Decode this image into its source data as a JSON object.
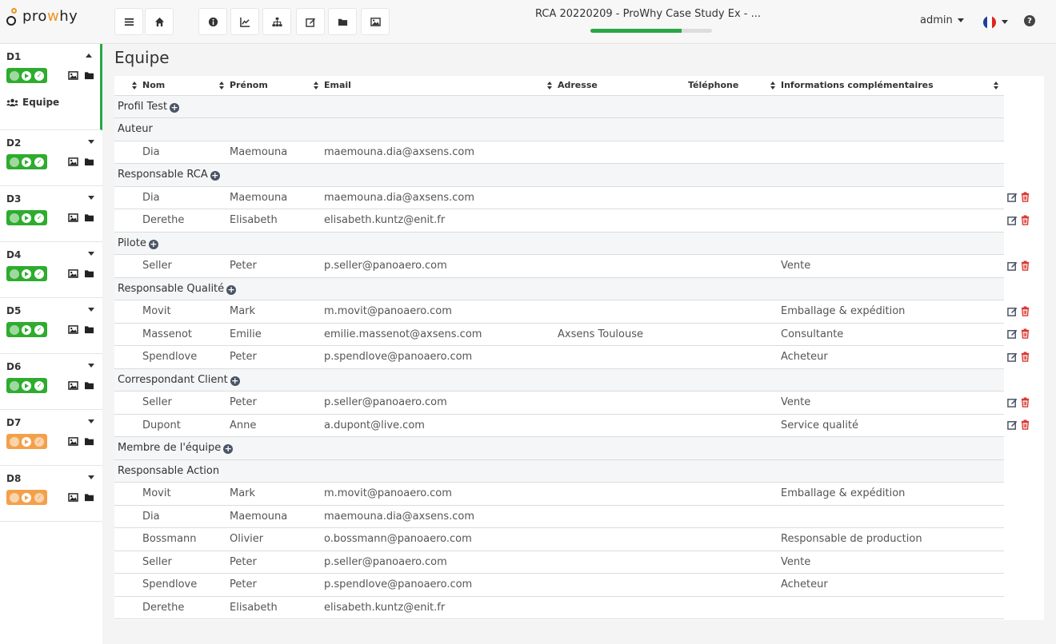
{
  "app": {
    "logo_text_a": "pro",
    "logo_text_b": "w",
    "logo_text_c": "hy"
  },
  "header": {
    "doc_title": "RCA 20220209 - ProWhy Case Study Ex - ...",
    "progress": 0.75,
    "user": "admin",
    "toolbar": [
      "menu-icon",
      "home-icon",
      "info-icon",
      "chart-icon",
      "sitemap-icon",
      "edit-icon",
      "folder-icon",
      "image-icon"
    ]
  },
  "sidebar": {
    "steps": [
      {
        "label": "D1",
        "status": "green",
        "active": true,
        "sub": "Equipe"
      },
      {
        "label": "D2",
        "status": "green"
      },
      {
        "label": "D3",
        "status": "green"
      },
      {
        "label": "D4",
        "status": "green"
      },
      {
        "label": "D5",
        "status": "green"
      },
      {
        "label": "D6",
        "status": "green"
      },
      {
        "label": "D7",
        "status": "orange"
      },
      {
        "label": "D8",
        "status": "orange"
      }
    ]
  },
  "main": {
    "title": "Equipe",
    "columns": [
      "Nom",
      "Prénom",
      "Email",
      "Adresse",
      "Téléphone",
      "Informations complémentaires"
    ],
    "rows": [
      {
        "type": "group",
        "label": "Profil Test",
        "add": true
      },
      {
        "type": "group",
        "label": "Auteur",
        "add": false
      },
      {
        "type": "row",
        "cells": [
          "Dia",
          "Maemouna",
          "maemouna.dia@axsens.com",
          "",
          "",
          ""
        ],
        "actions": false
      },
      {
        "type": "group",
        "label": "Responsable RCA",
        "add": true
      },
      {
        "type": "row",
        "cells": [
          "Dia",
          "Maemouna",
          "maemouna.dia@axsens.com",
          "",
          "",
          ""
        ],
        "actions": true
      },
      {
        "type": "row",
        "cells": [
          "Derethe",
          "Elisabeth",
          "elisabeth.kuntz@enit.fr",
          "",
          "",
          ""
        ],
        "actions": true
      },
      {
        "type": "group",
        "label": "Pilote",
        "add": true
      },
      {
        "type": "row",
        "cells": [
          "Seller",
          "Peter",
          "p.seller@panoaero.com",
          "",
          "",
          "Vente"
        ],
        "actions": true
      },
      {
        "type": "group",
        "label": "Responsable Qualité",
        "add": true
      },
      {
        "type": "row",
        "cells": [
          "Movit",
          "Mark",
          "m.movit@panoaero.com",
          "",
          "",
          "Emballage & expédition"
        ],
        "actions": true
      },
      {
        "type": "row",
        "cells": [
          "Massenot",
          "Emilie",
          "emilie.massenot@axsens.com",
          "Axsens Toulouse",
          "",
          "Consultante"
        ],
        "actions": true
      },
      {
        "type": "row",
        "cells": [
          "Spendlove",
          "Peter",
          "p.spendlove@panoaero.com",
          "",
          "",
          "Acheteur"
        ],
        "actions": true
      },
      {
        "type": "group",
        "label": "Correspondant Client",
        "add": true
      },
      {
        "type": "row",
        "cells": [
          "Seller",
          "Peter",
          "p.seller@panoaero.com",
          "",
          "",
          "Vente"
        ],
        "actions": true
      },
      {
        "type": "row",
        "cells": [
          "Dupont",
          "Anne",
          "a.dupont@live.com",
          "",
          "",
          "Service qualité"
        ],
        "actions": true
      },
      {
        "type": "group",
        "label": "Membre de l'équipe",
        "add": true
      },
      {
        "type": "group",
        "label": "Responsable Action",
        "add": false
      },
      {
        "type": "row",
        "cells": [
          "Movit",
          "Mark",
          "m.movit@panoaero.com",
          "",
          "",
          "Emballage & expédition"
        ],
        "actions": false
      },
      {
        "type": "row",
        "cells": [
          "Dia",
          "Maemouna",
          "maemouna.dia@axsens.com",
          "",
          "",
          ""
        ],
        "actions": false
      },
      {
        "type": "row",
        "cells": [
          "Bossmann",
          "Olivier",
          "o.bossmann@panoaero.com",
          "",
          "",
          "Responsable de production"
        ],
        "actions": false
      },
      {
        "type": "row",
        "cells": [
          "Seller",
          "Peter",
          "p.seller@panoaero.com",
          "",
          "",
          "Vente"
        ],
        "actions": false
      },
      {
        "type": "row",
        "cells": [
          "Spendlove",
          "Peter",
          "p.spendlove@panoaero.com",
          "",
          "",
          "Acheteur"
        ],
        "actions": false
      },
      {
        "type": "row",
        "cells": [
          "Derethe",
          "Elisabeth",
          "elisabeth.kuntz@enit.fr",
          "",
          "",
          ""
        ],
        "actions": false
      }
    ]
  },
  "colors": {
    "green": "#2eac2e",
    "orange": "#f4a04a",
    "progress": "#28a745",
    "delete": "#d9342b"
  }
}
